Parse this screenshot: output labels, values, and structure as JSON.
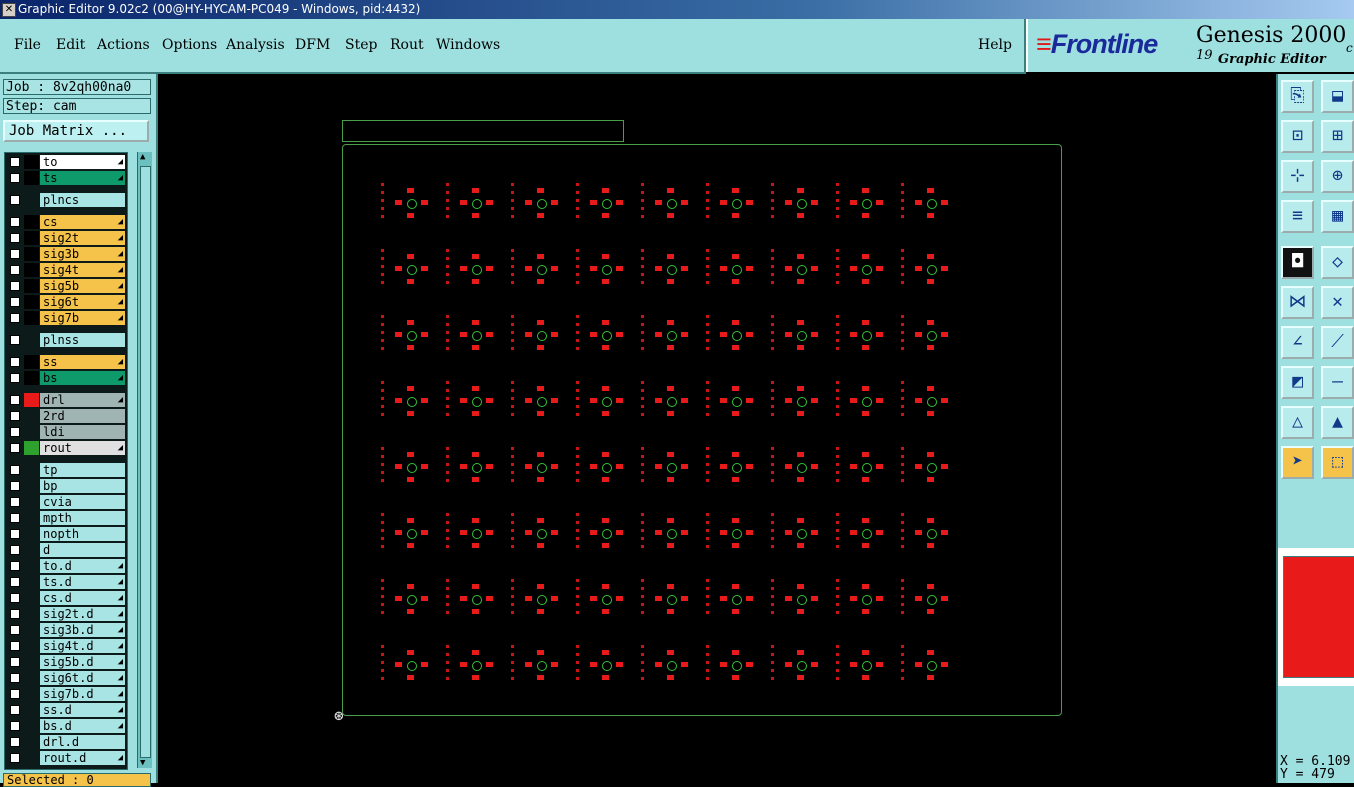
{
  "window": {
    "title": "Graphic Editor 9.02c2 (00@HY-HYCAM-PC049 - Windows, pid:4432)"
  },
  "menu": {
    "items": [
      "File",
      "Edit",
      "Actions",
      "Options",
      "Analysis",
      "DFM",
      "Step",
      "Rout",
      "Windows"
    ],
    "help": "Help"
  },
  "brand": {
    "logo": "Frontline",
    "product": "Genesis 2000",
    "sup": "19",
    "subtitle": "Graphic Editor",
    "edge": "c"
  },
  "job": {
    "job_line": "Job : 8v2qh00na0",
    "step_line": "Step: cam",
    "matrix_button": "Job Matrix ..."
  },
  "layers": [
    {
      "name": "to",
      "bg": "#ffffff",
      "chip": "#000000",
      "arrow": true
    },
    {
      "name": "ts",
      "bg": "#0e9a6a",
      "chip": "#000000",
      "arrow": true
    },
    {
      "name": "plncs",
      "bg": "#a8e4e4",
      "chip": "",
      "arrow": false
    },
    {
      "name": "cs",
      "bg": "#f5c24a",
      "chip": "#000000",
      "arrow": true
    },
    {
      "name": "sig2t",
      "bg": "#f5c24a",
      "chip": "#000000",
      "arrow": true
    },
    {
      "name": "sig3b",
      "bg": "#f5c24a",
      "chip": "#000000",
      "arrow": true
    },
    {
      "name": "sig4t",
      "bg": "#f5c24a",
      "chip": "#000000",
      "arrow": true
    },
    {
      "name": "sig5b",
      "bg": "#f5c24a",
      "chip": "#000000",
      "arrow": true
    },
    {
      "name": "sig6t",
      "bg": "#f5c24a",
      "chip": "#000000",
      "arrow": true
    },
    {
      "name": "sig7b",
      "bg": "#f5c24a",
      "chip": "#000000",
      "arrow": true
    },
    {
      "name": "plnss",
      "bg": "#a8e4e4",
      "chip": "",
      "arrow": false
    },
    {
      "name": "ss",
      "bg": "#f5c24a",
      "chip": "#000000",
      "arrow": true
    },
    {
      "name": "bs",
      "bg": "#0e9a6a",
      "chip": "#000000",
      "arrow": true
    },
    {
      "name": "drl",
      "bg": "#a0b4b4",
      "chip": "#e81a1a",
      "arrow": true
    },
    {
      "name": "2rd",
      "bg": "#a0b4b4",
      "chip": "",
      "arrow": false
    },
    {
      "name": "ldi",
      "bg": "#a0b4b4",
      "chip": "",
      "arrow": false
    },
    {
      "name": "rout",
      "bg": "#e0e0e0",
      "chip": "#2ea02e",
      "arrow": true
    },
    {
      "name": "tp",
      "bg": "#a8e4e4",
      "chip": "",
      "arrow": false
    },
    {
      "name": "bp",
      "bg": "#a8e4e4",
      "chip": "",
      "arrow": false
    },
    {
      "name": "cvia",
      "bg": "#a8e4e4",
      "chip": "",
      "arrow": false
    },
    {
      "name": "mpth",
      "bg": "#a8e4e4",
      "chip": "",
      "arrow": false
    },
    {
      "name": "nopth",
      "bg": "#a8e4e4",
      "chip": "",
      "arrow": false
    },
    {
      "name": "d",
      "bg": "#a8e4e4",
      "chip": "",
      "arrow": false
    },
    {
      "name": "to.d",
      "bg": "#a8e4e4",
      "chip": "",
      "arrow": true
    },
    {
      "name": "ts.d",
      "bg": "#a8e4e4",
      "chip": "",
      "arrow": true
    },
    {
      "name": "cs.d",
      "bg": "#a8e4e4",
      "chip": "",
      "arrow": true
    },
    {
      "name": "sig2t.d",
      "bg": "#a8e4e4",
      "chip": "",
      "arrow": true
    },
    {
      "name": "sig3b.d",
      "bg": "#a8e4e4",
      "chip": "",
      "arrow": true
    },
    {
      "name": "sig4t.d",
      "bg": "#a8e4e4",
      "chip": "",
      "arrow": true
    },
    {
      "name": "sig5b.d",
      "bg": "#a8e4e4",
      "chip": "",
      "arrow": true
    },
    {
      "name": "sig6t.d",
      "bg": "#a8e4e4",
      "chip": "",
      "arrow": true
    },
    {
      "name": "sig7b.d",
      "bg": "#a8e4e4",
      "chip": "",
      "arrow": true
    },
    {
      "name": "ss.d",
      "bg": "#a8e4e4",
      "chip": "",
      "arrow": true
    },
    {
      "name": "bs.d",
      "bg": "#a8e4e4",
      "chip": "",
      "arrow": true
    },
    {
      "name": "drl.d",
      "bg": "#a8e4e4",
      "chip": "",
      "arrow": false
    },
    {
      "name": "rout.d",
      "bg": "#a8e4e4",
      "chip": "",
      "arrow": true
    }
  ],
  "status": {
    "selected": "Selected : 0"
  },
  "coords": {
    "x": "X = 6.109",
    "y": "Y = 479"
  },
  "colors": {
    "pad": "#e81a1a",
    "ring": "#36c236",
    "outline": "#4a9e4a",
    "panel": "#9ee0e0",
    "active": "#f5c24a"
  },
  "tools": [
    {
      "name": "clipboard-icon",
      "glyph": "⎘"
    },
    {
      "name": "save-icon",
      "glyph": "⬓"
    },
    {
      "name": "zoom-home-icon",
      "glyph": "⊡"
    },
    {
      "name": "zoom-window-icon",
      "glyph": "⊞"
    },
    {
      "name": "pan-center-icon",
      "glyph": "⊹"
    },
    {
      "name": "fit-icon",
      "glyph": "⊕"
    },
    {
      "name": "ruler-icon",
      "glyph": "≡"
    },
    {
      "name": "grid-icon",
      "glyph": "▦"
    },
    {
      "name": "snap-icon",
      "glyph": "◘"
    },
    {
      "name": "measure-icon",
      "glyph": "◇"
    },
    {
      "name": "connect-icon",
      "glyph": "⋈"
    },
    {
      "name": "cross-icon",
      "glyph": "✕"
    },
    {
      "name": "line-edit-icon",
      "glyph": "∠"
    },
    {
      "name": "line-move-icon",
      "glyph": "⟋"
    },
    {
      "name": "pad-icon",
      "glyph": "◩"
    },
    {
      "name": "segment-icon",
      "glyph": "—"
    },
    {
      "name": "triangle-icon",
      "glyph": "△"
    },
    {
      "name": "triangle-select-icon",
      "glyph": "▲"
    },
    {
      "name": "pointer-icon",
      "glyph": "➤"
    },
    {
      "name": "pointer-box-icon",
      "glyph": "⬚"
    }
  ]
}
